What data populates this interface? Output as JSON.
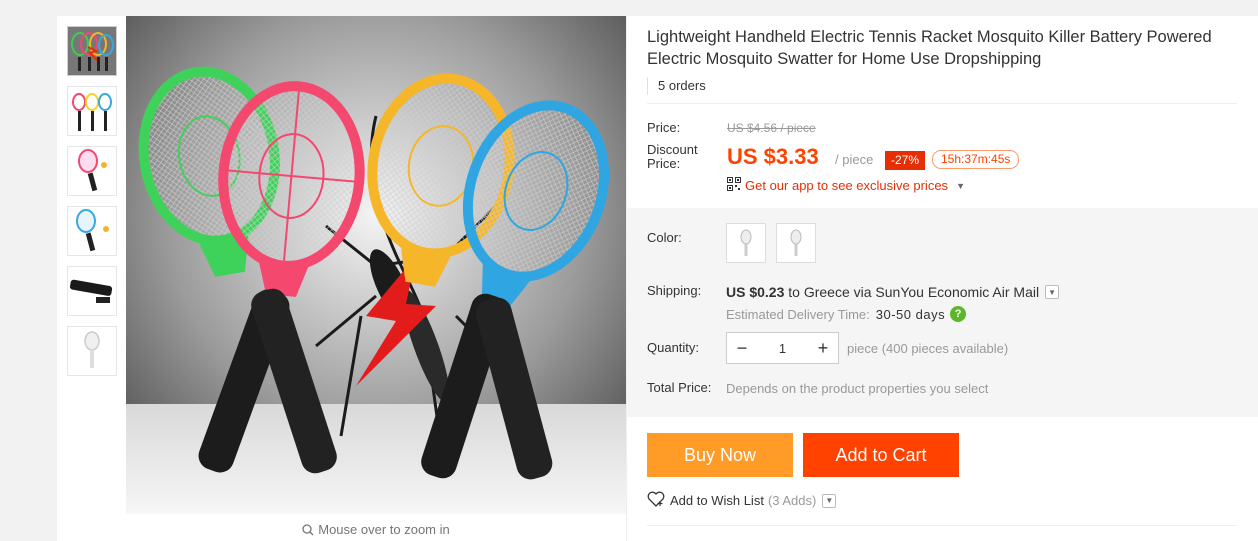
{
  "product": {
    "title": "Lightweight Handheld Electric Tennis Racket Mosquito Killer Battery Powered Electric Mosquito Swatter for Home Use Dropshipping",
    "orders": "5 orders"
  },
  "gallery": {
    "zoom_hint": "Mouse over to zoom in",
    "thumbnails": [
      "thumb-1",
      "thumb-2",
      "thumb-3",
      "thumb-4",
      "thumb-5",
      "thumb-6"
    ]
  },
  "price": {
    "price_label": "Price:",
    "original": "US $4.56 / piece",
    "discount_label": "Discount Price:",
    "current": "US $3.33",
    "unit": "/ piece",
    "discount_badge": "-27%",
    "timer": "15h:37m:45s",
    "app_promo": "Get our app to see exclusive prices"
  },
  "options": {
    "color_label": "Color:",
    "shipping_label": "Shipping:",
    "shipping_price": "US $0.23",
    "shipping_to": "to Greece via SunYou Economic Air Mail",
    "delivery_label": "Estimated Delivery Time:",
    "delivery_days": "30-50 days",
    "quantity_label": "Quantity:",
    "quantity_value": "1",
    "availability": "piece (400 pieces available)",
    "total_label": "Total Price:",
    "total_value": "Depends on the product properties you select"
  },
  "actions": {
    "buy_now": "Buy Now",
    "add_to_cart": "Add to Cart",
    "wishlist": "Add to Wish List",
    "wishlist_count": "(3 Adds)"
  },
  "colors": {
    "accent": "#ff4200",
    "buy_now": "#ff9b26",
    "promo": "#e62e04"
  }
}
